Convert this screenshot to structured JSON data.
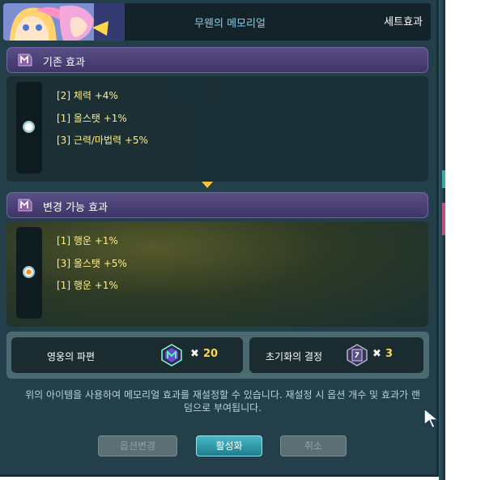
{
  "header": {
    "title": "무웬의 메모리얼",
    "set_effect_button": "세트효과"
  },
  "existing": {
    "title": "기존 효과",
    "options": [
      "[2] 체력 +4%",
      "[1] 올스탯 +1%",
      "[3] 근력/마법력 +5%"
    ]
  },
  "changeable": {
    "title": "변경 가능 효과",
    "options": [
      "[1] 행운 +1%",
      "[3] 올스탯 +5%",
      "[1] 행운 +1%"
    ]
  },
  "costs": [
    {
      "label": "영웅의 파편",
      "count": "20",
      "icon": "hero-fragment-icon"
    },
    {
      "label": "초기화의 결정",
      "count": "3",
      "icon": "reset-crystal-icon"
    }
  ],
  "multiply_sign": "✖",
  "notice": "위의 아이템을 사용하여 메모리얼 효과를 재설정할 수 있습니다. 재설정 시 옵션 개수 및 효과가 랜덤으로 부여됩니다.",
  "buttons": {
    "change": "옵션변경",
    "activate": "활성화",
    "cancel": "취소"
  },
  "colors": {
    "accent": "#7fd3ee",
    "option_text": "#ffef88",
    "section_header": "#4a4078",
    "count": "#ffd84a"
  }
}
